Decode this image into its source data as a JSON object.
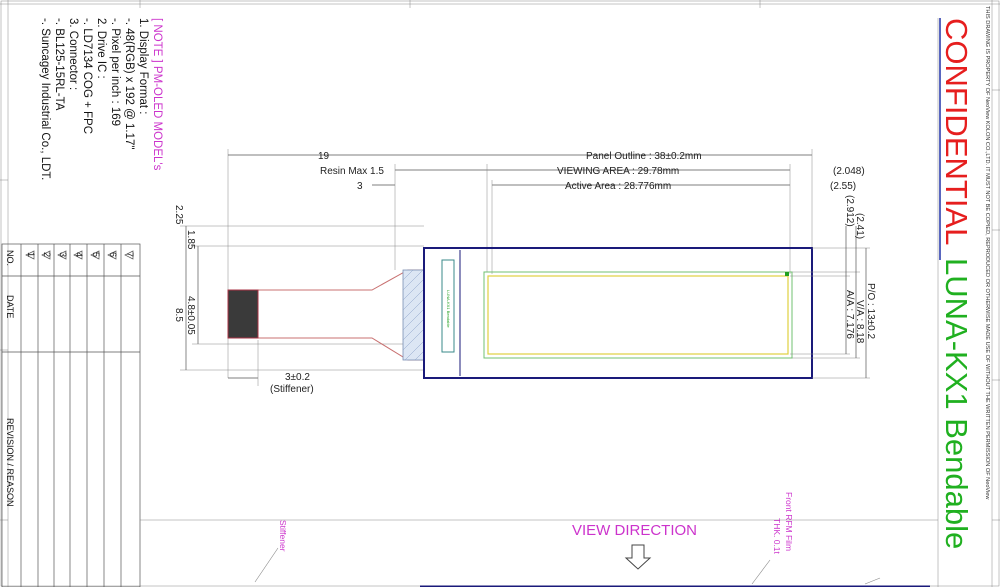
{
  "colors": {
    "confidential": "#e61e1e",
    "model": "#20b020",
    "note_accent": "#cc33cc",
    "panel_outline": "#1a1a7a",
    "active_area": "#e0d040",
    "viewing_area": "#70c070"
  },
  "title_block": {
    "confidential": "CONFIDENTIAL",
    "model": "LUNA-KX1 Bendable",
    "legal_notice": "THIS DRAWING IS PROPERTY OF NeoView KOLON CO.,LTD. IT MUST NOT BE COPIED, REPRODUCED OR OTHERWISE MADE USE OF WITHOUT THE WRITTEN PERMISSION OF NeoView"
  },
  "notes": {
    "header": "[ NOTE ] PM-OLED MODEL's",
    "lines": [
      "1. Display Format :",
      "  -. 48(RGB) x 192 @ 1.17\"",
      "  -. Pixel per inch : 169",
      "2. Drive IC :",
      "  -. LD7134 COG + FPC",
      "3. Connector :",
      "  -. BL125-15RL-TA",
      "  -. Suncagey Industrial Co., LDT."
    ]
  },
  "revision_table": {
    "col_no": "NO.",
    "col_date": "DATE",
    "col_reason": "REVISION / REASON",
    "markers": [
      "1",
      "2",
      "3",
      "4",
      "5",
      "6",
      "7"
    ]
  },
  "dimensions": {
    "overall_length": "19",
    "panel_outline": "Panel Outline : 38±0.2mm",
    "resin_max": "Resin Max 1.5",
    "viewing_area": "VIEWING AREA : 29.78mm",
    "active_area": "Active Area : 28.776mm",
    "three": "3",
    "right_2048": "(2.048)",
    "right_255": "(2.55)",
    "v_225": "2.25",
    "v_185": "1.85",
    "v_48": "4.8±0.05",
    "v_85": "8.5",
    "v_241": "(2.41)",
    "v_2912": "(2.912)",
    "po": "P/O : 13±0.2",
    "va": "V/A : 8.18",
    "aa": "A/A : 7.176",
    "stiffener_dim": "3±0.2",
    "stiffener_label": "(Stiffener)",
    "panel_text": "LUNA-KX1 Bendable"
  },
  "callouts": {
    "stiffener": "Stiffener",
    "front_film_1": "Front RFM Film",
    "front_film_2": "THK. 0.1t",
    "view_direction": "VIEW DIRECTION"
  }
}
